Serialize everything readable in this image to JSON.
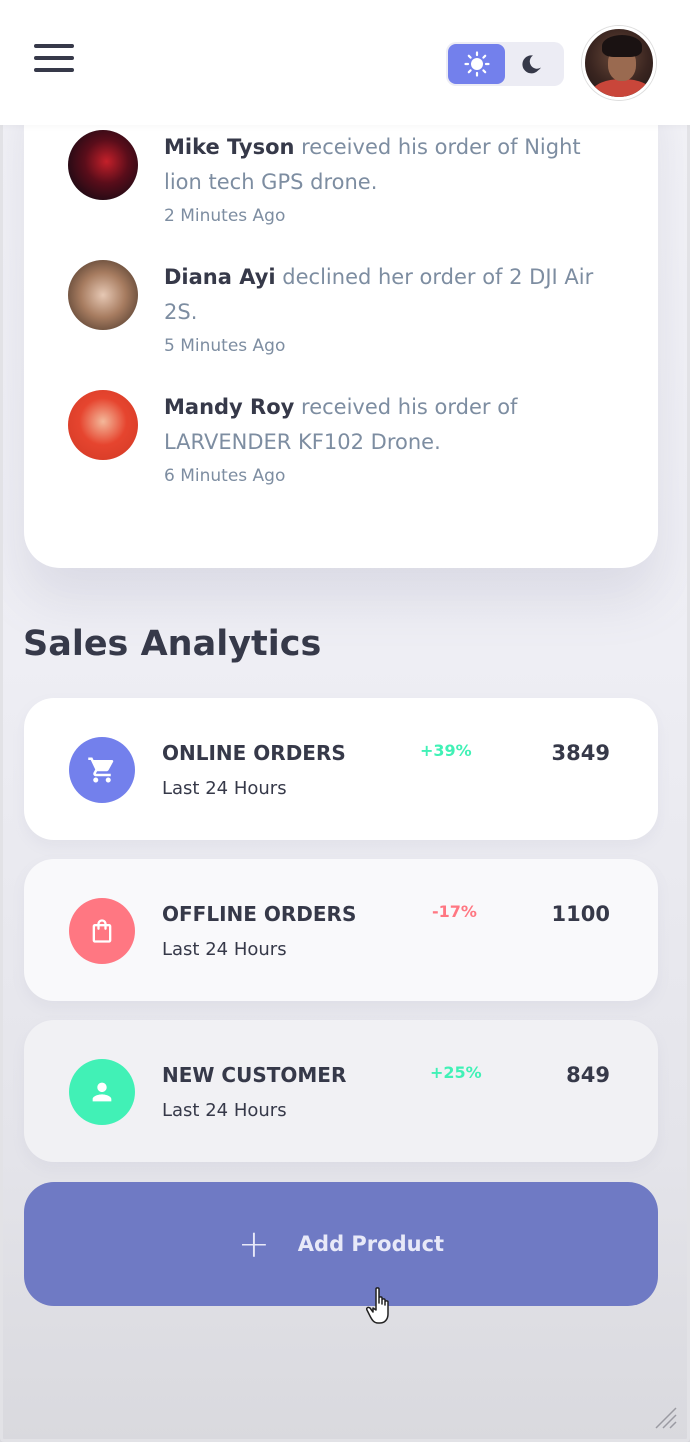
{
  "header": {
    "menu_icon": "hamburger-menu-icon",
    "theme_toggle": {
      "light_icon": "sun-icon",
      "dark_icon": "moon-icon",
      "active": "light"
    },
    "profile_avatar": "user-avatar"
  },
  "updates": [
    {
      "name": "Mike Tyson",
      "text": " received his order of Night lion tech GPS drone.",
      "time": "2 Minutes Ago"
    },
    {
      "name": "Diana Ayi",
      "text": " declined her order of 2 DJI Air 2S.",
      "time": "5 Minutes Ago"
    },
    {
      "name": "Mandy Roy",
      "text": " received his order of LARVENDER KF102 Drone.",
      "time": "6 Minutes Ago"
    }
  ],
  "sales_analytics": {
    "title": "Sales Analytics",
    "items": [
      {
        "title": "ONLINE ORDERS",
        "subtitle": "Last 24 Hours",
        "change": "+39%",
        "value": "3849",
        "icon": "cart-icon",
        "icon_color": "#7380ec",
        "change_color": "#41f1b6"
      },
      {
        "title": "OFFLINE ORDERS",
        "subtitle": "Last 24 Hours",
        "change": "-17%",
        "value": "1100",
        "icon": "shopping-bag-icon",
        "icon_color": "#ff7782",
        "change_color": "#ff7782"
      },
      {
        "title": "NEW CUSTOMER",
        "subtitle": "Last 24 Hours",
        "change": "+25%",
        "value": "849",
        "icon": "person-icon",
        "icon_color": "#41f1b6",
        "change_color": "#41f1b6"
      }
    ]
  },
  "add_product": {
    "label": "Add Product",
    "icon": "plus-icon"
  },
  "colors": {
    "primary": "#7380ec",
    "danger": "#ff7782",
    "success": "#41f1b6",
    "dark": "#363949",
    "muted": "#7d8da1"
  }
}
